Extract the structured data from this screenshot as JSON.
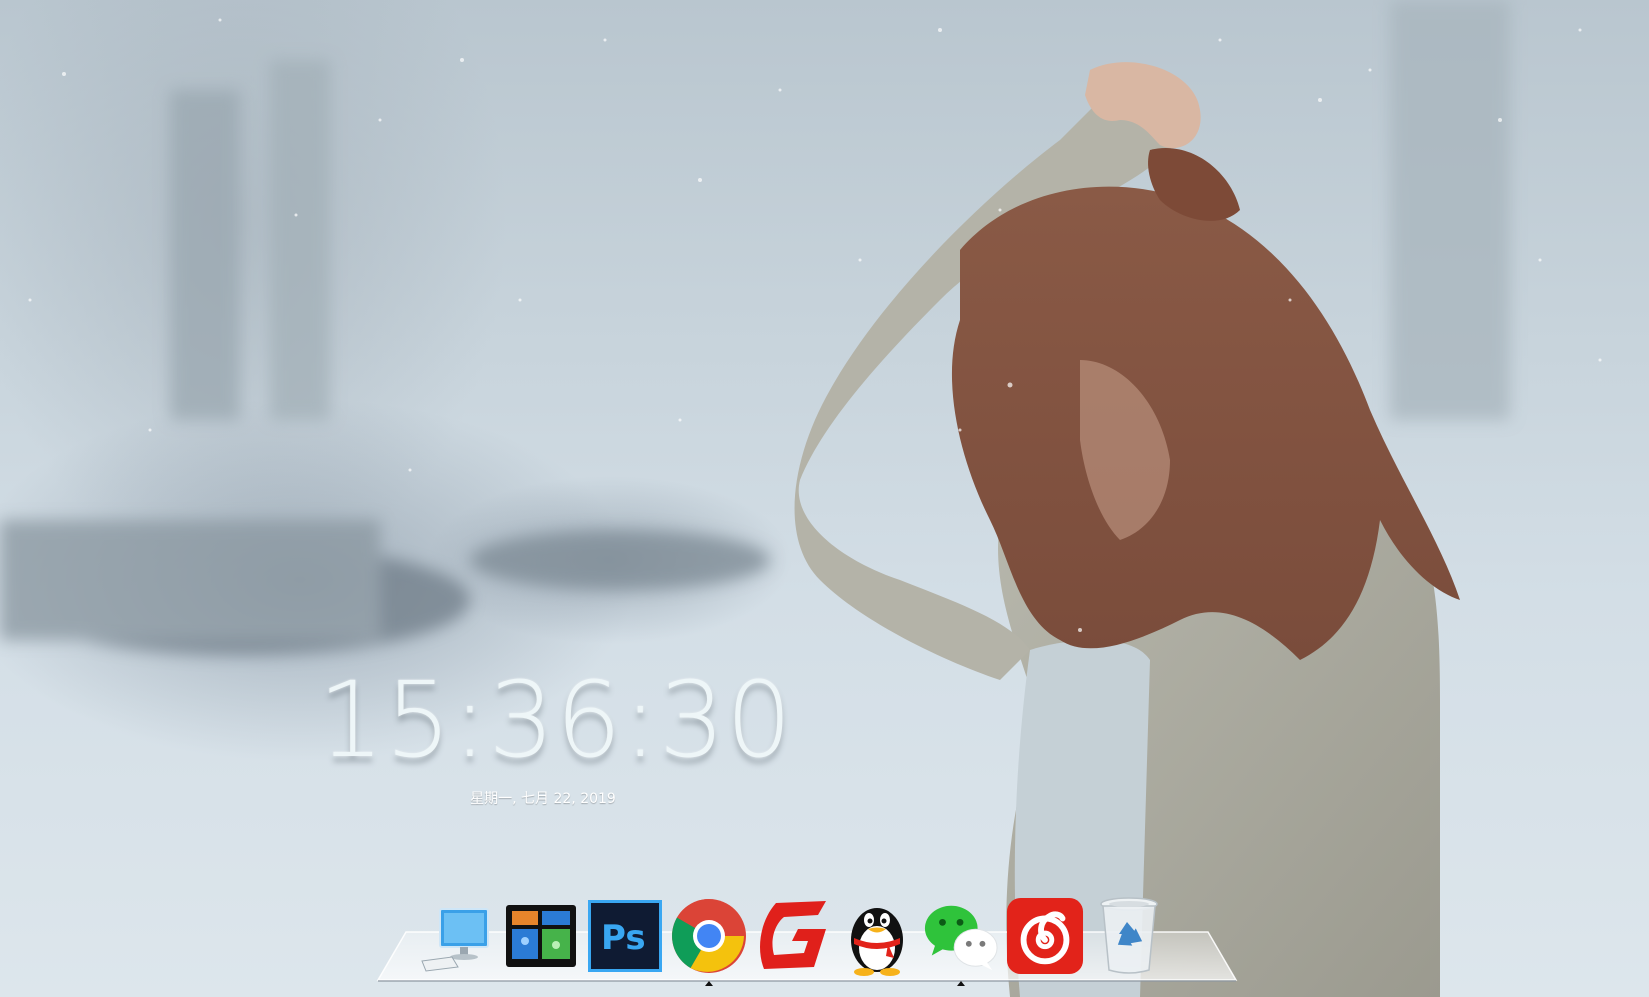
{
  "clock": {
    "time": "15:36:30",
    "date": "星期一, 七月 22, 2019"
  },
  "dock": {
    "items": [
      {
        "icon": "computer-icon",
        "running": false
      },
      {
        "icon": "task-view-icon",
        "running": false
      },
      {
        "icon": "photoshop-icon",
        "label": "Ps",
        "running": false
      },
      {
        "icon": "chrome-icon",
        "running": true
      },
      {
        "icon": "app-g-icon",
        "running": false
      },
      {
        "icon": "qq-penguin-icon",
        "running": false
      },
      {
        "icon": "wechat-icon",
        "running": true
      },
      {
        "icon": "netease-music-icon",
        "running": false
      },
      {
        "icon": "recycle-bin-icon",
        "running": false
      }
    ]
  },
  "colors": {
    "photoshop_bg": "#0f1b33",
    "photoshop_fg": "#39a7f2",
    "chrome_red": "#db4437",
    "chrome_yellow": "#f4c20d",
    "chrome_green": "#0f9d58",
    "chrome_blue": "#4285f4",
    "netease_red": "#e2231a",
    "wechat_green": "#2fc33b"
  }
}
